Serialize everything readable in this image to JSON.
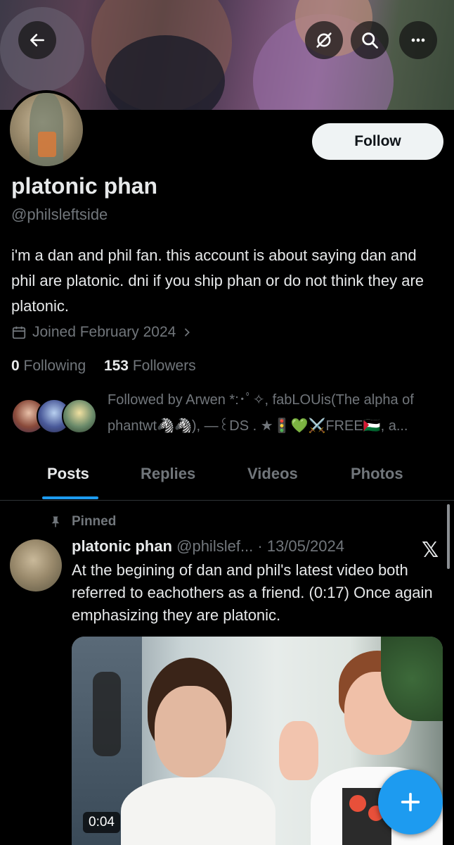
{
  "header": {
    "back_icon": "arrow-left-icon",
    "actions": [
      "eye-off-icon",
      "search-icon",
      "more-icon"
    ]
  },
  "profile": {
    "follow_label": "Follow",
    "name": "platonic phan",
    "handle": "@philsleftside",
    "bio": "i'm a dan and phil fan. this account is about saying dan and phil are platonic. dni if you ship phan or do not think they are platonic.",
    "joined": "Joined February 2024",
    "following_count": "0",
    "following_label": "Following",
    "followers_count": "153",
    "followers_label": "Followers",
    "followed_by_line1": "Followed by Arwen *:･ﾟ✧, fabLOUis(The alpha of",
    "followed_by_line2": "phantwt🦓🦓), —꒰DS . ★🚦💚⚔️FREE🇵🇸, a..."
  },
  "tabs": [
    {
      "label": "Posts",
      "active": true
    },
    {
      "label": "Replies",
      "active": false
    },
    {
      "label": "Videos",
      "active": false
    },
    {
      "label": "Photos",
      "active": false
    }
  ],
  "post": {
    "pinned_label": "Pinned",
    "author_name": "platonic phan",
    "author_handle_date": "@philslef... · 13/05/2024",
    "text": "At the begining of dan and phil's latest video both referred to eachothers as a friend. (0:17) Once again emphasizing they are platonic.",
    "video_duration": "0:04",
    "source_logo": "𝕏"
  },
  "colors": {
    "accent": "#1d9bf0",
    "background": "#000000",
    "secondary_text": "#71767b"
  }
}
